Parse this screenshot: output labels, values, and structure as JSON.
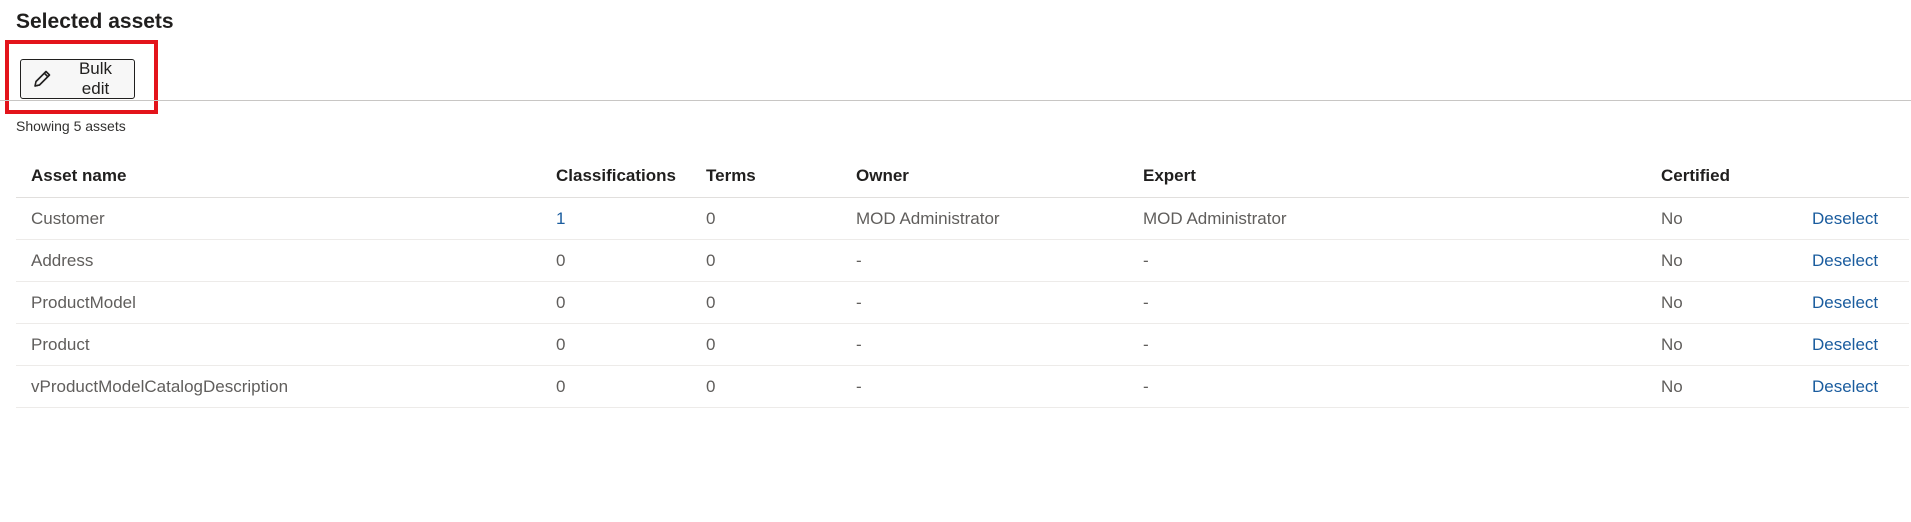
{
  "page": {
    "title": "Selected assets",
    "showing_text": "Showing 5 assets"
  },
  "toolbar": {
    "bulk_edit_label": "Bulk edit",
    "bulk_edit_icon": "pencil-icon",
    "highlight_color": "#e3141b"
  },
  "table": {
    "headers": {
      "name": "Asset name",
      "classifications": "Classifications",
      "terms": "Terms",
      "owner": "Owner",
      "expert": "Expert",
      "certified": "Certified"
    },
    "rows": [
      {
        "name": "Customer",
        "classifications": "1",
        "terms": "0",
        "owner": "MOD Administrator",
        "expert": "MOD Administrator",
        "certified": "No",
        "action": "Deselect"
      },
      {
        "name": "Address",
        "classifications": "0",
        "terms": "0",
        "owner": "-",
        "expert": "-",
        "certified": "No",
        "action": "Deselect"
      },
      {
        "name": "ProductModel",
        "classifications": "0",
        "terms": "0",
        "owner": "-",
        "expert": "-",
        "certified": "No",
        "action": "Deselect"
      },
      {
        "name": "Product",
        "classifications": "0",
        "terms": "0",
        "owner": "-",
        "expert": "-",
        "certified": "No",
        "action": "Deselect"
      },
      {
        "name": "vProductModelCatalogDescription",
        "classifications": "0",
        "terms": "0",
        "owner": "-",
        "expert": "-",
        "certified": "No",
        "action": "Deselect"
      }
    ]
  },
  "colors": {
    "link": "#1a5c9e"
  }
}
